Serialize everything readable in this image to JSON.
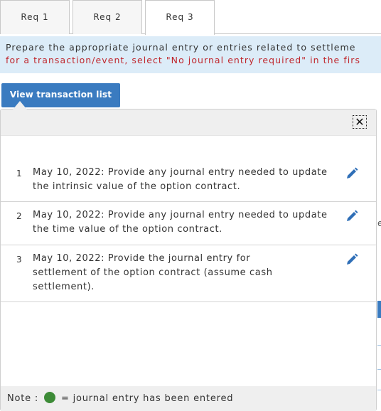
{
  "tabs": [
    {
      "label": "Req 1"
    },
    {
      "label": "Req 2"
    },
    {
      "label": "Req 3"
    }
  ],
  "instruction": {
    "line1": "Prepare the appropriate journal entry or entries related to settleme",
    "line2": "for a transaction/event, select \"No journal entry required\" in the firs"
  },
  "view_button": {
    "label": "View transaction list"
  },
  "background": {
    "partial_letter": "e"
  },
  "popup": {
    "close_label": "✕",
    "items": [
      {
        "num": "1",
        "text": "May 10, 2022: Provide any journal entry needed to update the intrinsic value of the option contract."
      },
      {
        "num": "2",
        "text": "May 10, 2022: Provide any journal entry needed to update the time value of the option contract."
      },
      {
        "num": "3",
        "text": "May 10, 2022: Provide the journal entry for settlement of the option contract (assume cash settlement)."
      }
    ],
    "note": {
      "prefix": "Note :",
      "suffix": "= journal entry has been entered"
    }
  },
  "colors": {
    "accent": "#3a7bc0",
    "entered_dot": "#3d8b37",
    "instruction_bg": "#dcecf8",
    "warning_text": "#c0272d"
  }
}
